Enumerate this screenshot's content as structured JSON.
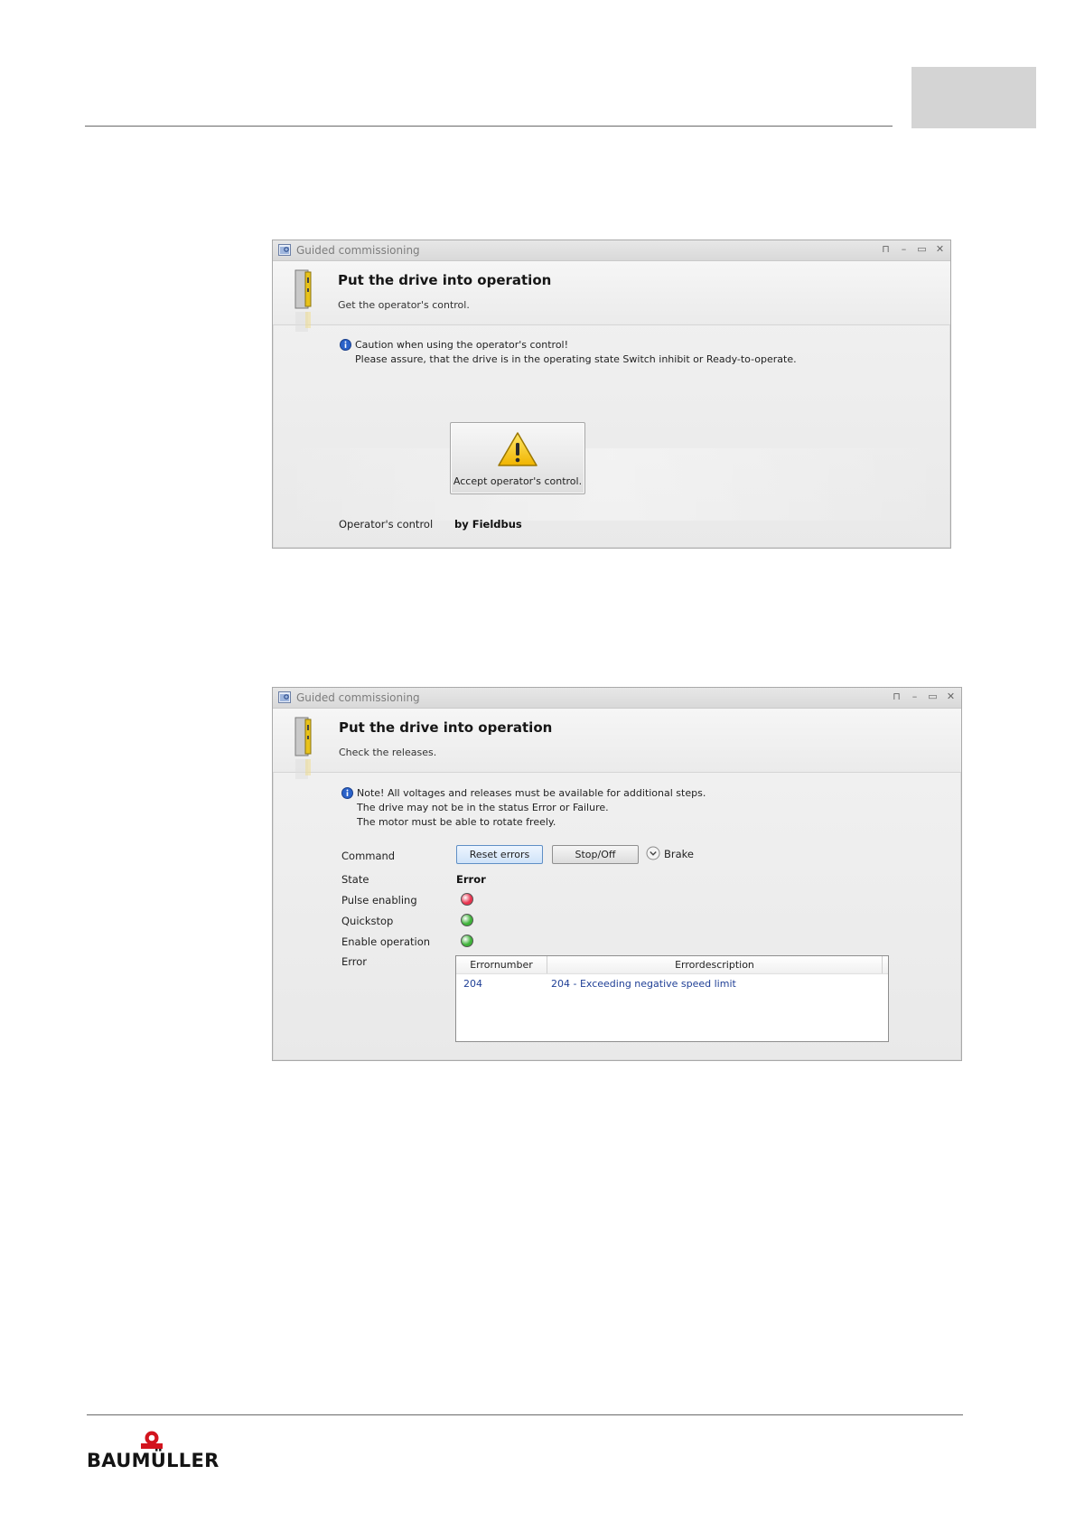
{
  "window1": {
    "title": "Guided commissioning",
    "controls": [
      "⊓",
      "–",
      "▭",
      "✕"
    ],
    "heading": "Put the drive into operation",
    "subheading": "Get the operator's control.",
    "note_line1": "Caution when using the operator's control!",
    "note_line2": "Please assure, that the drive is in the operating state Switch inhibit or Ready-to-operate.",
    "accept_button": "Accept operator's control.",
    "control_label": "Operator's control",
    "control_value": "by Fieldbus"
  },
  "window2": {
    "title": "Guided commissioning",
    "controls": [
      "⊓",
      "–",
      "▭",
      "✕"
    ],
    "heading": "Put the drive into operation",
    "subheading": "Check the releases.",
    "note_line1": "Note! All voltages and releases must be available for additional steps.",
    "note_line2": "The drive may not be in the status Error or Failure.",
    "note_line3": "The motor must be able to rotate freely.",
    "command_label": "Command",
    "reset_button": "Reset errors",
    "stop_button": "Stop/Off",
    "brake_label": "Brake",
    "state_label": "State",
    "state_value": "Error",
    "pulse_label": "Pulse enabling",
    "quickstop_label": "Quickstop",
    "enable_label": "Enable operation",
    "error_label": "Error",
    "status_colors": {
      "pulse": "#e8344f",
      "quickstop": "#3fb23a",
      "enable": "#3fb23a"
    },
    "error_table": {
      "columns": [
        "Errornumber",
        "Errordescription"
      ],
      "rows": [
        {
          "number": "204",
          "description": "204 - Exceeding negative speed limit"
        }
      ]
    }
  },
  "footer": {
    "logo_text": "BAUMÜLLER"
  }
}
